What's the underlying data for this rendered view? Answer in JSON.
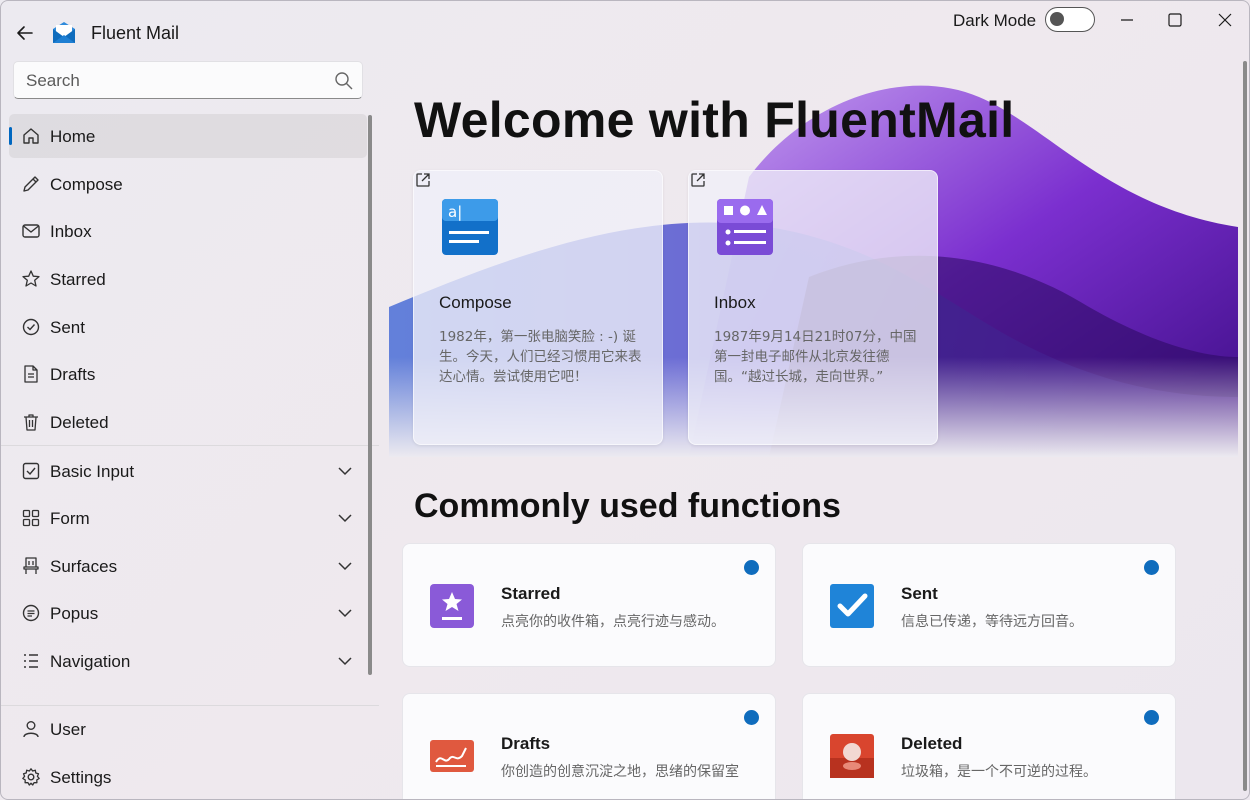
{
  "window": {
    "title": "Fluent Mail",
    "dark_mode_label": "Dark Mode",
    "dark_mode_on": false
  },
  "search": {
    "placeholder": "Search"
  },
  "sidebar": {
    "items": [
      {
        "label": "Home",
        "icon": "home-icon",
        "active": true
      },
      {
        "label": "Compose",
        "icon": "pencil-icon"
      },
      {
        "label": "Inbox",
        "icon": "mail-icon"
      },
      {
        "label": "Starred",
        "icon": "star-icon"
      },
      {
        "label": "Sent",
        "icon": "check-circle-icon"
      },
      {
        "label": "Drafts",
        "icon": "document-icon"
      },
      {
        "label": "Deleted",
        "icon": "trash-icon"
      },
      {
        "label": "Basic Input",
        "icon": "checkbox-icon",
        "expandable": true
      },
      {
        "label": "Form",
        "icon": "grid-icon",
        "expandable": true
      },
      {
        "label": "Surfaces",
        "icon": "chair-icon",
        "expandable": true
      },
      {
        "label": "Popus",
        "icon": "list-circle-icon",
        "expandable": true
      },
      {
        "label": "Navigation",
        "icon": "list-icon",
        "expandable": true
      }
    ],
    "footer": [
      {
        "label": "User",
        "icon": "person-icon"
      },
      {
        "label": "Settings",
        "icon": "gear-icon"
      }
    ]
  },
  "main": {
    "welcome": "Welcome with FluentMail",
    "cards": [
      {
        "title": "Compose",
        "desc": "1982年，第一张电脑笑脸 : -) 诞生。今天，人们已经习惯用它来表达心情。尝试使用它吧！",
        "icon": "compose-app-icon"
      },
      {
        "title": "Inbox",
        "desc": "1987年9月14日21时07分，中国第一封电子邮件从北京发往德国。“越过长城，走向世界。”",
        "icon": "inbox-app-icon"
      }
    ],
    "section_title": "Commonly used functions",
    "functions": [
      {
        "title": "Starred",
        "desc": "点亮你的收件箱，点亮行迹与感动。",
        "icon": "starred-app-icon"
      },
      {
        "title": "Sent",
        "desc": "信息已传递，等待远方回音。",
        "icon": "sent-app-icon"
      },
      {
        "title": "Drafts",
        "desc": "你创造的创意沉淀之地，思绪的保留室",
        "icon": "drafts-app-icon"
      },
      {
        "title": "Deleted",
        "desc": "垃圾箱，是一个不可逆的过程。",
        "icon": "deleted-app-icon"
      }
    ]
  },
  "colors": {
    "accent": "#0067c0",
    "dot": "#0f6cbd",
    "hero_purple": "#6b1fb8"
  }
}
